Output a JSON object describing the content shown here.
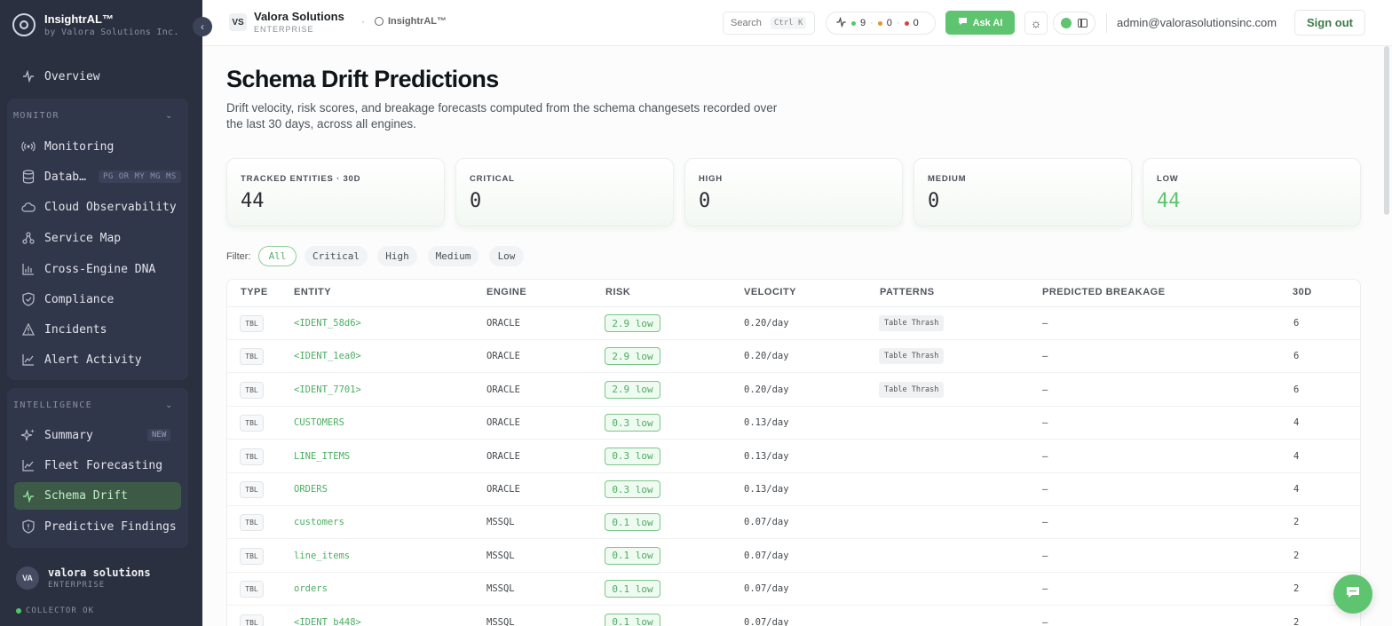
{
  "brand": {
    "name": "InsightrAL™",
    "sub": "by Valora Solutions Inc."
  },
  "nav": {
    "overview": "Overview",
    "monitor_title": "MONITOR",
    "monitor_items": [
      "Monitoring",
      "Datab…",
      "Cloud Observability",
      "Service Map",
      "Cross-Engine DNA",
      "Compliance",
      "Incidents",
      "Alert Activity"
    ],
    "db_tags": "PG OR MY MG MS",
    "intelligence_title": "INTELLIGENCE",
    "intelligence_items": [
      "Summary",
      "Fleet Forecasting",
      "Schema Drift",
      "Predictive Findings"
    ],
    "new_tag": "NEW"
  },
  "footer": {
    "avatar": "VA",
    "name": "valora solutions",
    "plan": "ENTERPRISE",
    "collector": "COLLECTOR OK"
  },
  "header": {
    "org_badge": "VS",
    "org_name": "Valora Solutions",
    "org_plan": "ENTERPRISE",
    "app_name": "InsightrAL™",
    "search_label": "Search",
    "search_kbd": "Ctrl K",
    "status": {
      "ok": "9",
      "warn": "0",
      "crit": "0"
    },
    "ask_ai": "Ask AI",
    "email": "admin@valorasolutionsinc.com",
    "signout": "Sign out"
  },
  "page": {
    "title": "Schema Drift Predictions",
    "description": "Drift velocity, risk scores, and breakage forecasts computed from the schema changesets recorded over the last 30 days, across all engines."
  },
  "stats": [
    {
      "label": "TRACKED ENTITIES · 30D",
      "value": "44"
    },
    {
      "label": "CRITICAL",
      "value": "0"
    },
    {
      "label": "HIGH",
      "value": "0"
    },
    {
      "label": "MEDIUM",
      "value": "0"
    },
    {
      "label": "LOW",
      "value": "44"
    }
  ],
  "filter": {
    "label": "Filter:",
    "options": [
      "All",
      "Critical",
      "High",
      "Medium",
      "Low"
    ],
    "active": "All"
  },
  "table": {
    "headers": [
      "TYPE",
      "ENTITY",
      "ENGINE",
      "RISK",
      "VELOCITY",
      "PATTERNS",
      "PREDICTED BREAKAGE",
      "30D"
    ],
    "rows": [
      {
        "type": "TBL",
        "entity": "<IDENT_58d6>",
        "engine": "ORACLE",
        "risk": "2.9 low",
        "velocity": "0.20/day",
        "pattern": "Table Thrash",
        "breakage": "—",
        "d30": "6"
      },
      {
        "type": "TBL",
        "entity": "<IDENT_1ea0>",
        "engine": "ORACLE",
        "risk": "2.9 low",
        "velocity": "0.20/day",
        "pattern": "Table Thrash",
        "breakage": "—",
        "d30": "6"
      },
      {
        "type": "TBL",
        "entity": "<IDENT_7701>",
        "engine": "ORACLE",
        "risk": "2.9 low",
        "velocity": "0.20/day",
        "pattern": "Table Thrash",
        "breakage": "—",
        "d30": "6"
      },
      {
        "type": "TBL",
        "entity": "CUSTOMERS",
        "engine": "ORACLE",
        "risk": "0.3 low",
        "velocity": "0.13/day",
        "pattern": "",
        "breakage": "—",
        "d30": "4"
      },
      {
        "type": "TBL",
        "entity": "LINE_ITEMS",
        "engine": "ORACLE",
        "risk": "0.3 low",
        "velocity": "0.13/day",
        "pattern": "",
        "breakage": "—",
        "d30": "4"
      },
      {
        "type": "TBL",
        "entity": "ORDERS",
        "engine": "ORACLE",
        "risk": "0.3 low",
        "velocity": "0.13/day",
        "pattern": "",
        "breakage": "—",
        "d30": "4"
      },
      {
        "type": "TBL",
        "entity": "customers",
        "engine": "MSSQL",
        "risk": "0.1 low",
        "velocity": "0.07/day",
        "pattern": "",
        "breakage": "—",
        "d30": "2"
      },
      {
        "type": "TBL",
        "entity": "line_items",
        "engine": "MSSQL",
        "risk": "0.1 low",
        "velocity": "0.07/day",
        "pattern": "",
        "breakage": "—",
        "d30": "2"
      },
      {
        "type": "TBL",
        "entity": "orders",
        "engine": "MSSQL",
        "risk": "0.1 low",
        "velocity": "0.07/day",
        "pattern": "",
        "breakage": "—",
        "d30": "2"
      },
      {
        "type": "TBL",
        "entity": "<IDENT_b448>",
        "engine": "MSSQL",
        "risk": "0.1 low",
        "velocity": "0.07/day",
        "pattern": "",
        "breakage": "—",
        "d30": "2"
      }
    ]
  },
  "colors": {
    "accent": "#5ec46f",
    "sidebar": "#2b3040",
    "ok": "#4fc86a",
    "warn": "#e8912d",
    "crit": "#d6453d"
  }
}
